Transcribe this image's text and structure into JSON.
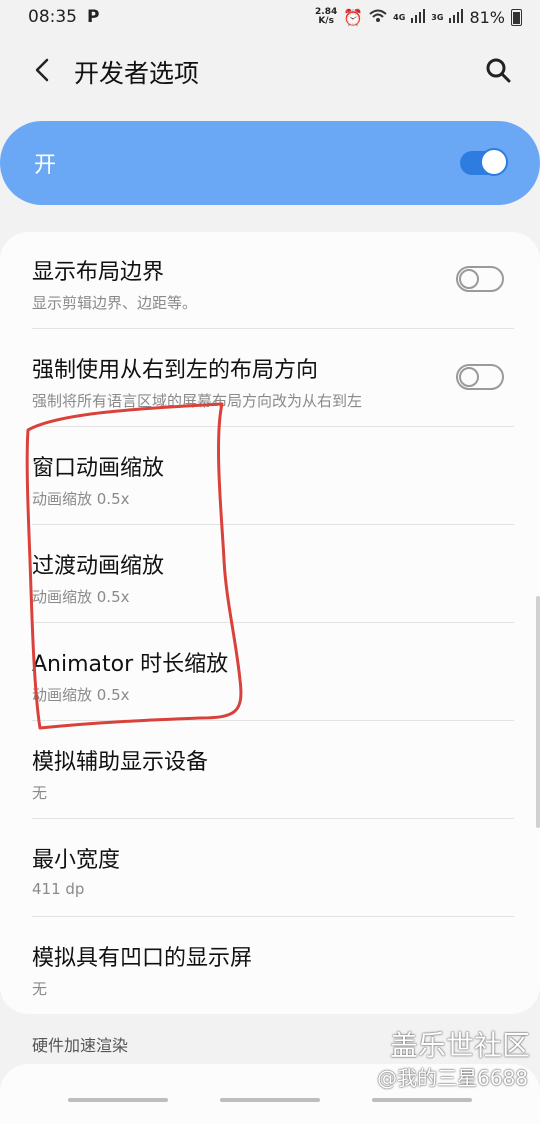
{
  "status_bar": {
    "time": "08:35",
    "p_icon": "P",
    "net_speed_value": "2.84",
    "net_speed_unit": "K/s",
    "net_4g": "4G",
    "net_3g": "3G",
    "battery": "81%"
  },
  "header": {
    "title": "开发者选项"
  },
  "master_switch": {
    "label": "开",
    "state": "on"
  },
  "settings": [
    {
      "title": "显示布局边界",
      "subtitle": "显示剪辑边界、边距等。",
      "toggle": "off"
    },
    {
      "title": "强制使用从右到左的布局方向",
      "subtitle": "强制将所有语言区域的屏幕布局方向改为从右到左",
      "toggle": "off"
    },
    {
      "title": "窗口动画缩放",
      "subtitle": "动画缩放 0.5x"
    },
    {
      "title": "过渡动画缩放",
      "subtitle": "动画缩放 0.5x"
    },
    {
      "title": "Animator 时长缩放",
      "subtitle": "动画缩放 0.5x"
    },
    {
      "title": "模拟辅助显示设备",
      "subtitle": "无"
    },
    {
      "title": "最小宽度",
      "subtitle": "411 dp"
    },
    {
      "title": "模拟具有凹口的显示屏",
      "subtitle": "无"
    }
  ],
  "section": {
    "label": "硬件加速渲染"
  },
  "watermark": {
    "text": "盖乐世社区",
    "credit": "@我的三星6688"
  },
  "colors": {
    "accent": "#6aa8f5",
    "switch_on": "#2d7de0",
    "annotation": "#d9413a"
  }
}
